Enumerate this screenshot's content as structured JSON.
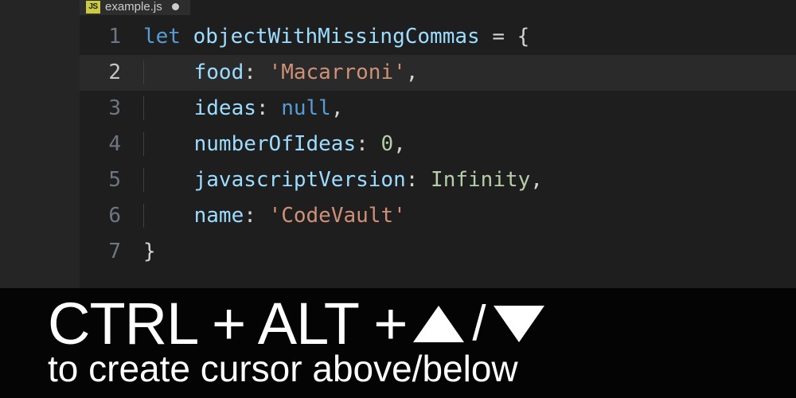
{
  "tab": {
    "icon_label": "JS",
    "filename": "example.js",
    "modified": true
  },
  "editor": {
    "lines": [
      {
        "n": "1",
        "indent": 0,
        "tokens": [
          {
            "t": "let",
            "c": "keyword"
          },
          {
            "t": " ",
            "c": "punct"
          },
          {
            "t": "objectWithMissingCommas",
            "c": "var"
          },
          {
            "t": " ",
            "c": "punct"
          },
          {
            "t": "=",
            "c": "op"
          },
          {
            "t": " ",
            "c": "punct"
          },
          {
            "t": "{",
            "c": "punct"
          }
        ]
      },
      {
        "n": "2",
        "indent": 1,
        "current": true,
        "tokens": [
          {
            "t": "food",
            "c": "prop"
          },
          {
            "t": ": ",
            "c": "punct"
          },
          {
            "t": "'Macarroni'",
            "c": "string"
          },
          {
            "t": ",",
            "c": "punct"
          }
        ]
      },
      {
        "n": "3",
        "indent": 1,
        "tokens": [
          {
            "t": "ideas",
            "c": "prop"
          },
          {
            "t": ": ",
            "c": "punct"
          },
          {
            "t": "null",
            "c": "null"
          },
          {
            "t": ",",
            "c": "punct"
          }
        ]
      },
      {
        "n": "4",
        "indent": 1,
        "tokens": [
          {
            "t": "numberOfIdeas",
            "c": "prop"
          },
          {
            "t": ": ",
            "c": "punct"
          },
          {
            "t": "0",
            "c": "num"
          },
          {
            "t": ",",
            "c": "punct"
          }
        ]
      },
      {
        "n": "5",
        "indent": 1,
        "tokens": [
          {
            "t": "javascriptVersion",
            "c": "prop"
          },
          {
            "t": ": ",
            "c": "punct"
          },
          {
            "t": "Infinity",
            "c": "num"
          },
          {
            "t": ",",
            "c": "punct"
          }
        ]
      },
      {
        "n": "6",
        "indent": 1,
        "tokens": [
          {
            "t": "name",
            "c": "prop"
          },
          {
            "t": ": ",
            "c": "punct"
          },
          {
            "t": "'CodeVault'",
            "c": "string"
          }
        ]
      },
      {
        "n": "7",
        "indent": 0,
        "tokens": [
          {
            "t": "}",
            "c": "punct"
          }
        ]
      }
    ]
  },
  "caption": {
    "keys": "CTRL + ALT + ",
    "sep": "/",
    "line2": "to create cursor above/below"
  }
}
